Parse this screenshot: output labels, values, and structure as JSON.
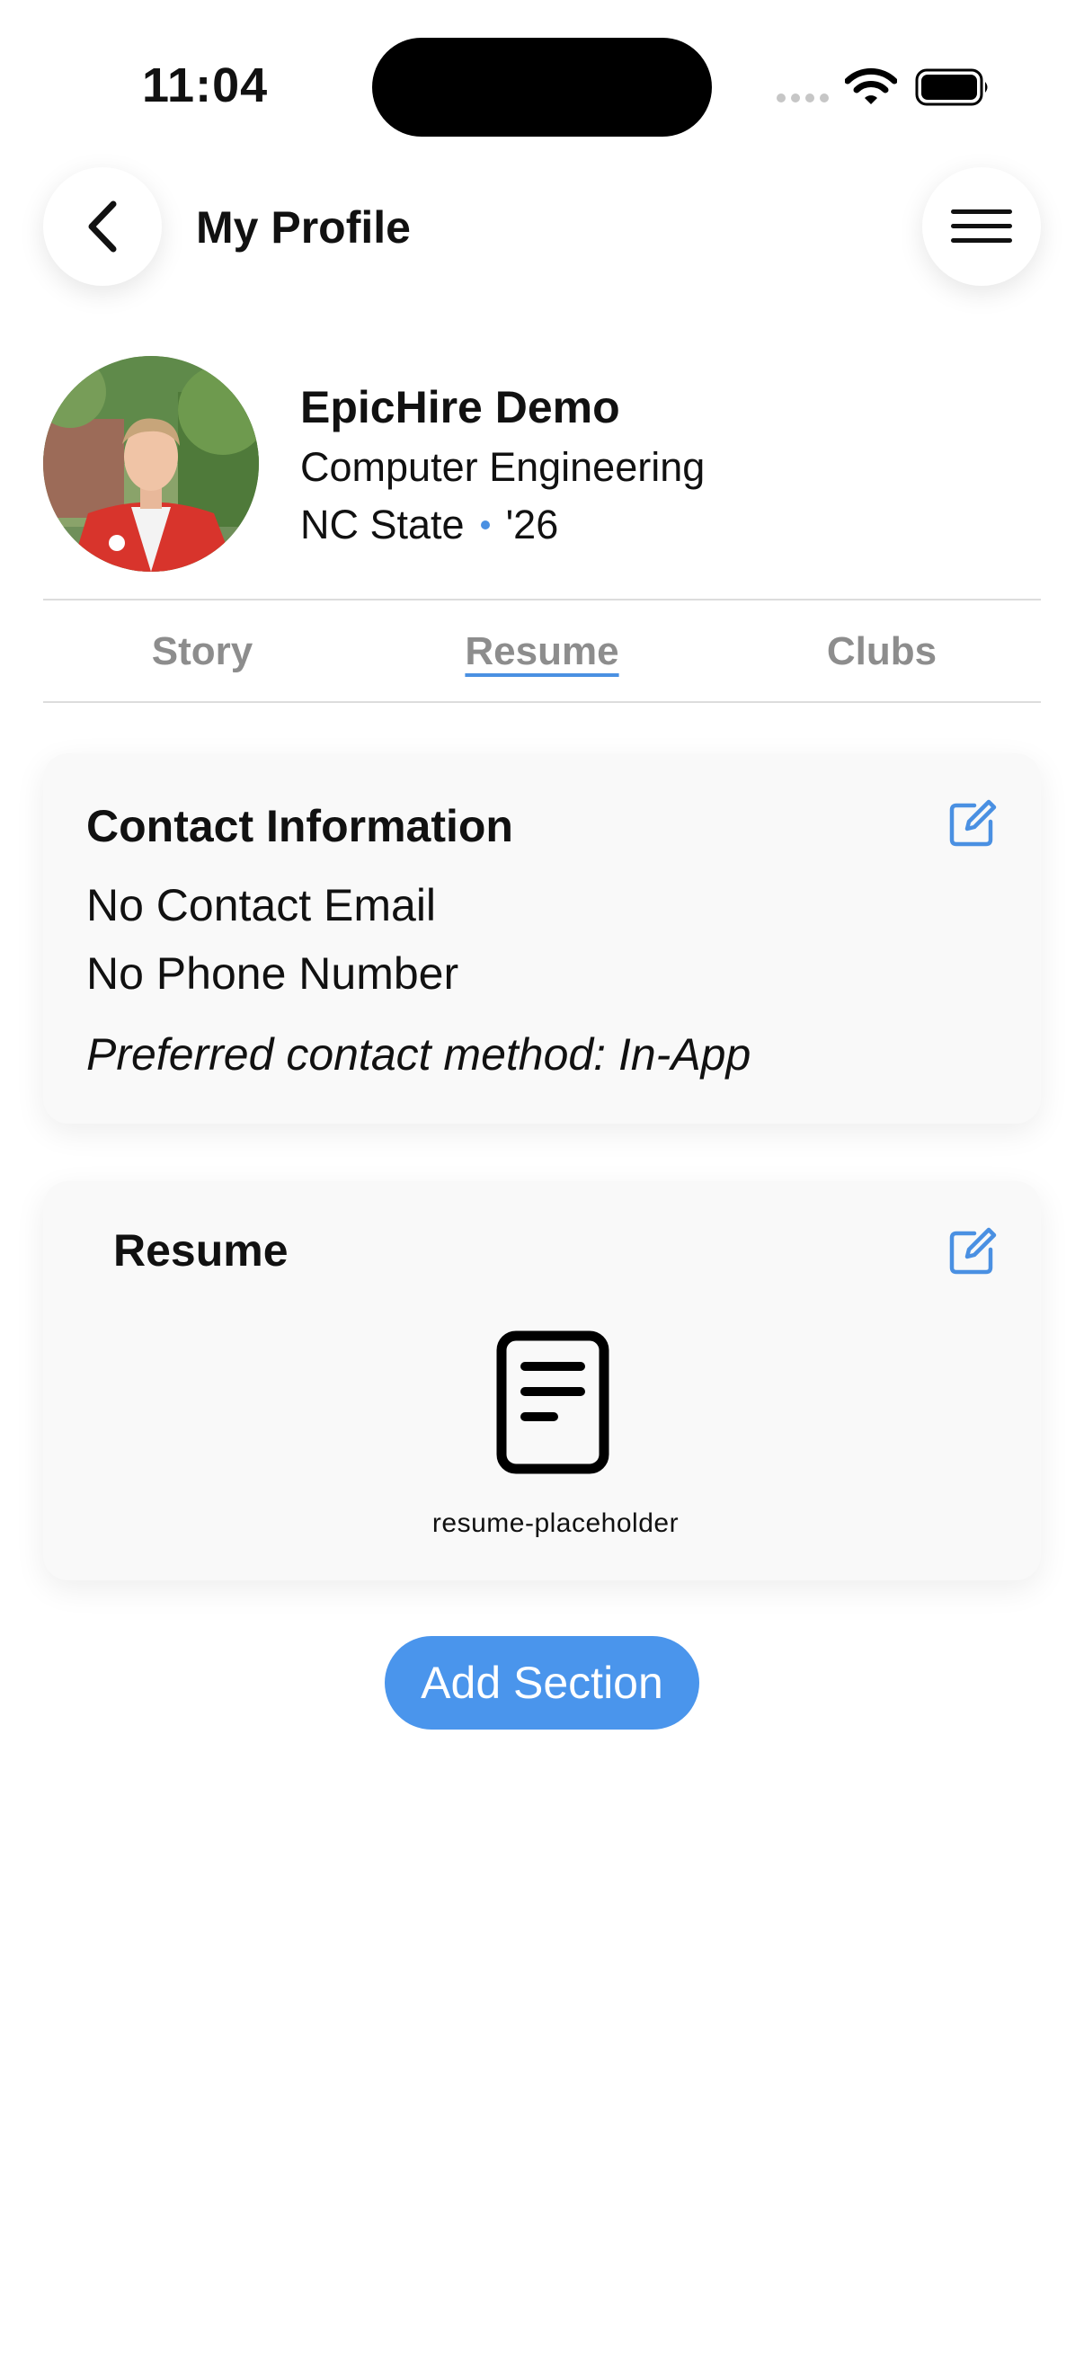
{
  "status_bar": {
    "time": "11:04",
    "icons": [
      "cellular-signal-icon",
      "wifi-icon",
      "battery-icon"
    ]
  },
  "header": {
    "title": "My Profile",
    "back_icon": "chevron-left-icon",
    "menu_icon": "hamburger-menu-icon"
  },
  "profile": {
    "name": "EpicHire Demo",
    "major": "Computer Engineering",
    "school": "NC State",
    "year": "'26"
  },
  "tabs": [
    {
      "label": "Story",
      "active": false
    },
    {
      "label": "Resume",
      "active": true
    },
    {
      "label": "Clubs",
      "active": false
    }
  ],
  "contact_card": {
    "title": "Contact Information",
    "email": "No Contact Email",
    "phone": "No Phone Number",
    "preferred": "Preferred contact method: In-App",
    "edit_icon": "edit-icon"
  },
  "resume_card": {
    "title": "Resume",
    "file_label": "resume-placeholder",
    "file_icon": "document-icon",
    "edit_icon": "edit-icon"
  },
  "add_section_label": "Add Section",
  "colors": {
    "accent": "#4a90e2",
    "button": "#4a95ec",
    "card_background": "#f9f9f9",
    "tab_inactive": "#8d8d8d"
  }
}
